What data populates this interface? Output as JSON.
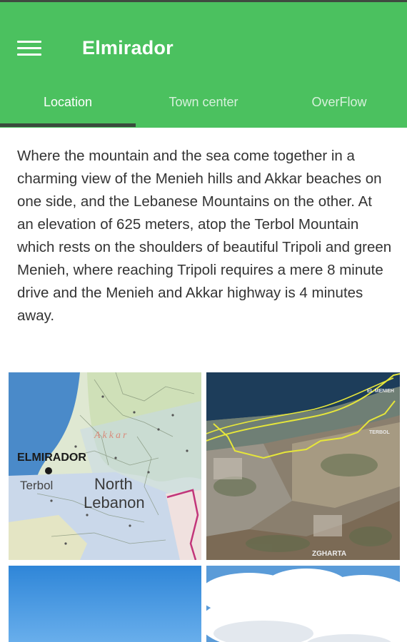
{
  "app": {
    "title": "Elmirador"
  },
  "tabs": [
    {
      "label": "Location",
      "active": true
    },
    {
      "label": "Town center",
      "active": false
    },
    {
      "label": "OverFlow",
      "active": false
    }
  ],
  "location": {
    "description": "Where the mountain and the sea come together in a charming view of the Menieh hills and Akkar beaches on one side, and the Lebanese Mountains on the other. At an elevation of 625 meters, atop the Terbol Mountain which rests on the shoulders of beautiful Tripoli and green Menieh, where reaching Tripoli requires a mere 8 minute drive and the Menieh and Akkar highway is 4 minutes away."
  },
  "gallery": {
    "map": {
      "place_label": "ELMIRADOR",
      "village_label": "Terbol",
      "region_line1": "North",
      "region_line2": "Lebanon",
      "faint_label": "Akkar"
    },
    "satellite": {
      "label_top": "EL MENIEH",
      "label_right": "TERBOL",
      "label_bottom": "ZGHARTA"
    }
  },
  "colors": {
    "appbar": "#4bc15f",
    "indicator": "#3a4a3d",
    "text": "#333333"
  }
}
